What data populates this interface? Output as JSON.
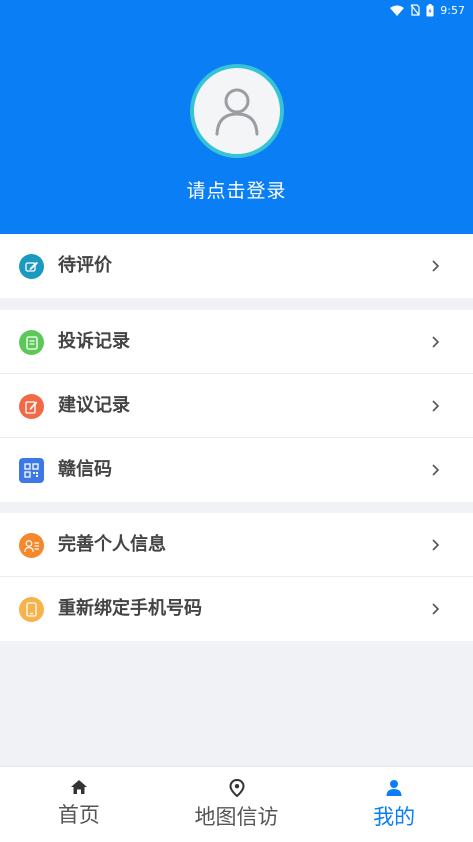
{
  "status_bar": {
    "time": "9:57"
  },
  "profile": {
    "login_prompt": "请点击登录"
  },
  "menu_groups": [
    {
      "items": [
        {
          "label": "待评价",
          "icon": "edit-icon",
          "color": "#1a9ac0"
        }
      ]
    },
    {
      "items": [
        {
          "label": "投诉记录",
          "icon": "list-icon",
          "color": "#5cc85a"
        },
        {
          "label": "建议记录",
          "icon": "note-edit-icon",
          "color": "#f26a45"
        },
        {
          "label": "赣信码",
          "icon": "qr-code-icon",
          "color": "#3d79e6"
        }
      ]
    },
    {
      "items": [
        {
          "label": "完善个人信息",
          "icon": "user-info-icon",
          "color": "#f5882a"
        },
        {
          "label": "重新绑定手机号码",
          "icon": "phone-icon",
          "color": "#f7b24a"
        }
      ]
    }
  ],
  "tab_bar": {
    "tabs": [
      {
        "label": "首页",
        "icon": "home-icon",
        "active": false
      },
      {
        "label": "地图信访",
        "icon": "location-pin-icon",
        "active": false
      },
      {
        "label": "我的",
        "icon": "person-icon",
        "active": true
      }
    ]
  },
  "colors": {
    "primary": "#0a7ff5",
    "avatar_ring": "#36c3d3"
  }
}
